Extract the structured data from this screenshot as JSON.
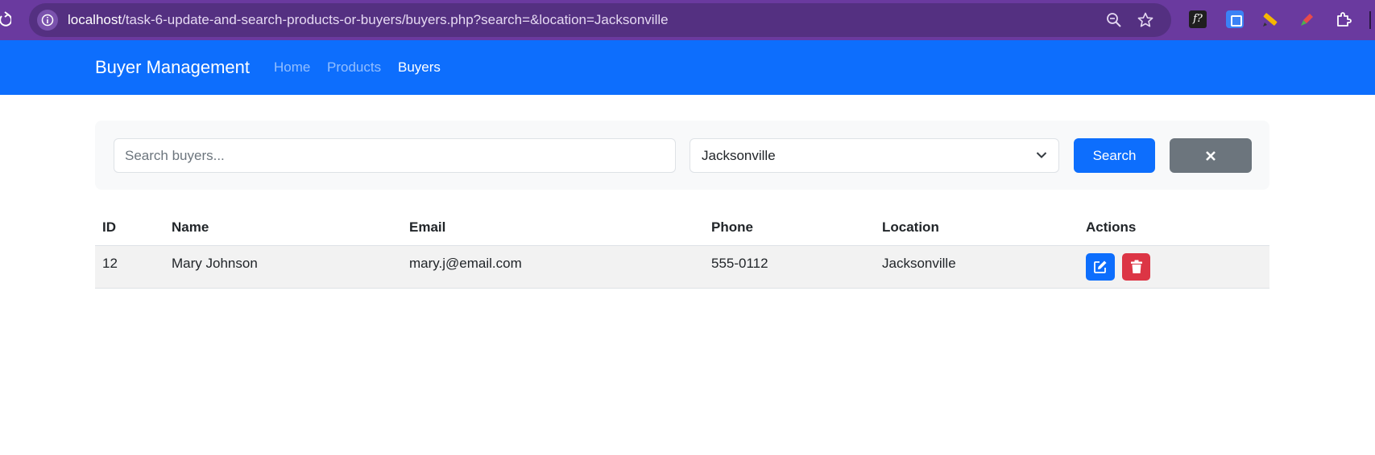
{
  "browser": {
    "url_host": "localhost",
    "url_path": "/task-6-update-and-search-products-or-buyers/buyers.php?search=&location=Jacksonville"
  },
  "navbar": {
    "brand": "Buyer Management",
    "links": [
      {
        "label": "Home",
        "active": false
      },
      {
        "label": "Products",
        "active": false
      },
      {
        "label": "Buyers",
        "active": true
      }
    ]
  },
  "filters": {
    "search_placeholder": "Search buyers...",
    "search_value": "",
    "location_selected": "Jacksonville",
    "search_button": "Search"
  },
  "table": {
    "headers": [
      "ID",
      "Name",
      "Email",
      "Phone",
      "Location",
      "Actions"
    ],
    "rows": [
      {
        "id": "12",
        "name": "Mary Johnson",
        "email": "mary.j@email.com",
        "phone": "555-0112",
        "location": "Jacksonville"
      }
    ]
  },
  "colors": {
    "primary": "#0d6efd",
    "danger": "#dc3545",
    "secondary": "#6c757d",
    "browser_frame": "#6a3a9f"
  }
}
